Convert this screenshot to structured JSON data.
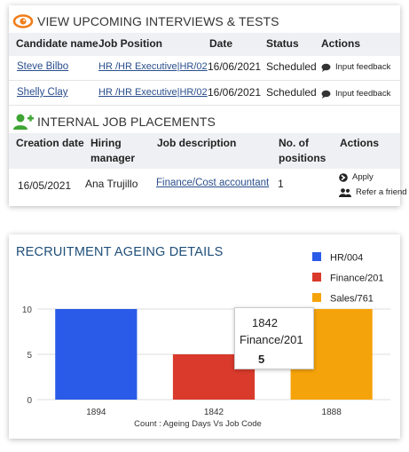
{
  "interviews": {
    "title": "VIEW UPCOMING INTERVIEWS & TESTS",
    "icon": "eye-icon",
    "columns": [
      "Candidate name",
      "Job Position",
      "Date",
      "Status",
      "Actions"
    ],
    "rows": [
      {
        "candidate": "Steve Bilbo",
        "position": "HR /HR Executive|HR/02",
        "date": "16/06/2021",
        "status": "Scheduled",
        "action": "Input feedback"
      },
      {
        "candidate": "Shelly Clay",
        "position": "HR /HR Executive|HR/02",
        "date": "16/06/2021",
        "status": "Scheduled",
        "action": "Input feedback"
      }
    ]
  },
  "placements": {
    "title": "INTERNAL JOB PLACEMENTS",
    "icon": "add-user-icon",
    "columns": {
      "creation_date": "Creation date",
      "hiring_manager_1": "Hiring",
      "hiring_manager_2": "manager",
      "job_description": "Job description",
      "positions_1": "No. of",
      "positions_2": "positions",
      "actions": "Actions"
    },
    "rows": [
      {
        "creation_date": "16/05/2021",
        "manager": "Ana Trujillo",
        "description": "Finance/Cost accountant",
        "positions": "1",
        "apply": "Apply",
        "refer": "Refer a friend"
      }
    ]
  },
  "colors": {
    "link": "#2a4e8c",
    "chart_title": "#1f4e79",
    "bar_blue": "#2a5ae8",
    "bar_red": "#d93a2b",
    "bar_orange": "#f5a30a"
  },
  "chart_data": {
    "type": "bar",
    "title": "RECRUITMENT AGEING DETAILS",
    "xlabel": "Count : Ageing Days Vs Job Code",
    "ylabel": "",
    "categories": [
      "1894",
      "1842",
      "1888"
    ],
    "yticks": [
      0,
      5,
      10
    ],
    "ylim": [
      0,
      10
    ],
    "grid": true,
    "legend_position": "top-right",
    "series": [
      {
        "name": "HR/004",
        "color": "#2a5ae8",
        "category": "1894",
        "value": 10
      },
      {
        "name": "Finance/201",
        "color": "#d93a2b",
        "category": "1842",
        "value": 5
      },
      {
        "name": "Sales/761",
        "color": "#f5a30a",
        "category": "1888",
        "value": 10
      }
    ],
    "tooltip": {
      "category": "1842",
      "series": "Finance/201",
      "value": "5"
    }
  }
}
